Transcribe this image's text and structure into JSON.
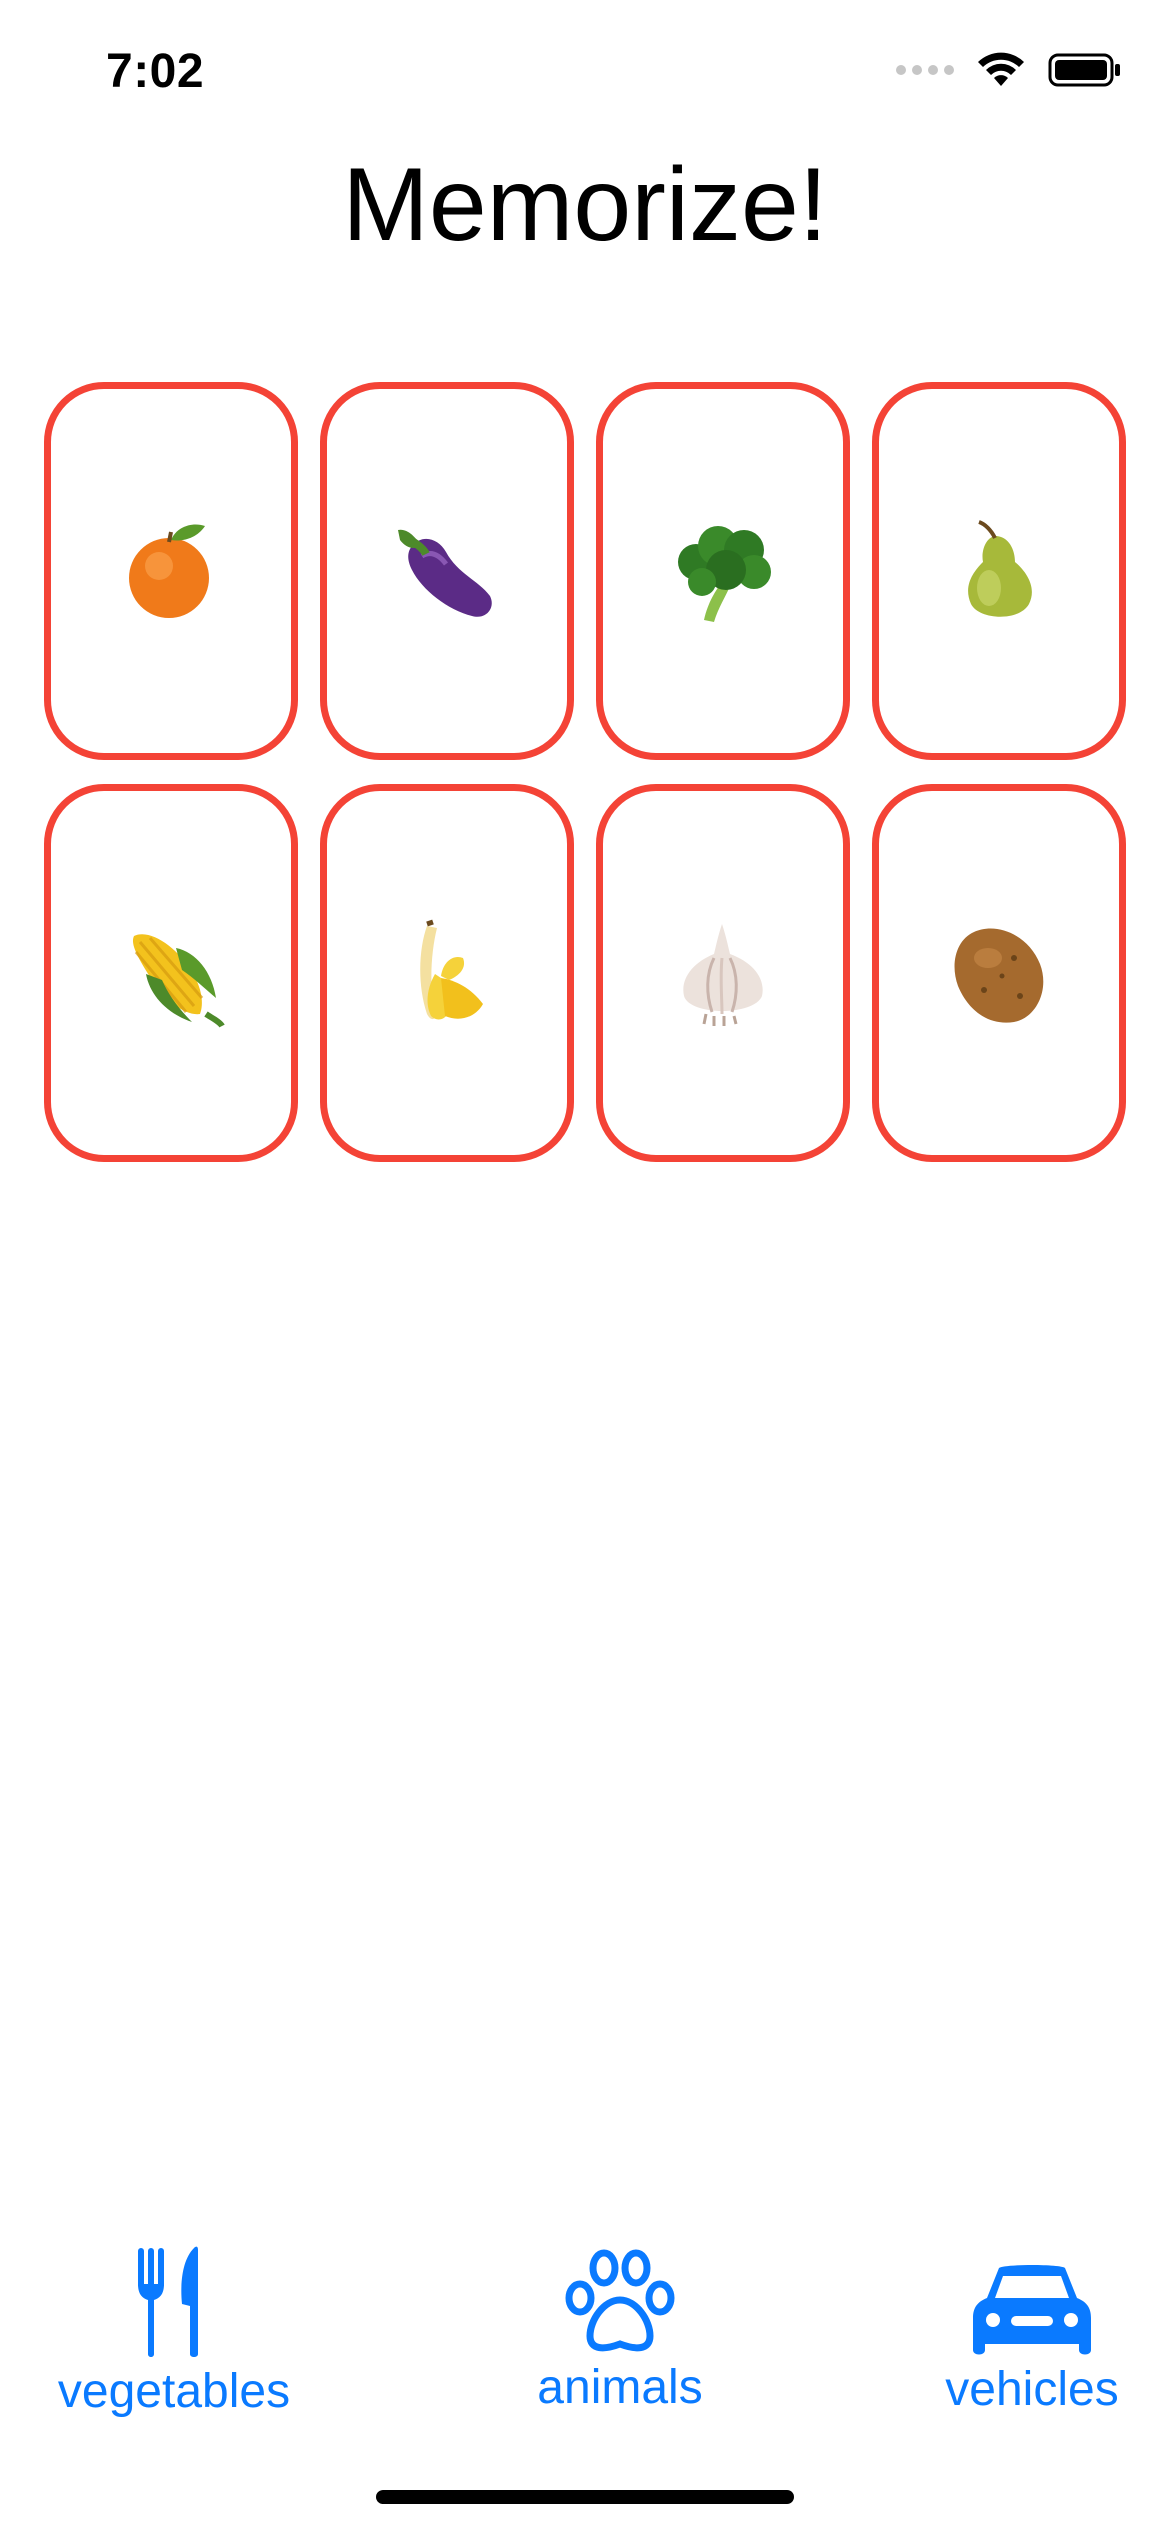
{
  "status_bar": {
    "time": "7:02",
    "icons": [
      "cellular-signal-icon",
      "wifi-icon",
      "battery-icon"
    ]
  },
  "title": "Memorize!",
  "cards": [
    {
      "emoji": "tangerine",
      "color": "#f44336"
    },
    {
      "emoji": "eggplant",
      "color": "#f44336"
    },
    {
      "emoji": "broccoli",
      "color": "#f44336"
    },
    {
      "emoji": "pear",
      "color": "#f44336"
    },
    {
      "emoji": "corn",
      "color": "#f44336"
    },
    {
      "emoji": "banana",
      "color": "#f44336"
    },
    {
      "emoji": "garlic",
      "color": "#f44336"
    },
    {
      "emoji": "potato",
      "color": "#f44336"
    }
  ],
  "tabs": [
    {
      "label": "vegetables",
      "icon": "fork-knife-icon"
    },
    {
      "label": "animals",
      "icon": "pawprint-icon"
    },
    {
      "label": "vehicles",
      "icon": "car-icon"
    }
  ],
  "colors": {
    "accent": "#0a7aff",
    "card_border": "#f44336"
  }
}
